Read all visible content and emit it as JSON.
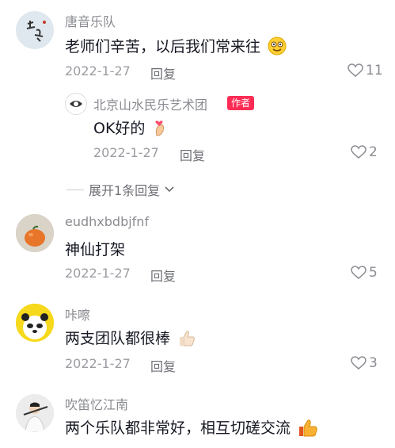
{
  "comments": [
    {
      "username": "唐音乐队",
      "text": "老师们辛苦，以后我们常来往",
      "emoji": "smiling-face-icon",
      "date": "2022-1-27",
      "reply_label": "回复",
      "likes": "11",
      "reply": {
        "username": "北京山水民乐艺术团",
        "badge": "作者",
        "text": "OK好的",
        "emoji": "finger-heart-icon",
        "date": "2022-1-27",
        "reply_label": "回复",
        "likes": "2"
      },
      "expand_label": "展开1条回复"
    },
    {
      "username": "eudhxbdbjfnf",
      "text": "神仙打架",
      "date": "2022-1-27",
      "reply_label": "回复",
      "likes": "5"
    },
    {
      "username": "咔嚓",
      "text": "两支团队都很棒",
      "emoji": "thumbs-up-icon",
      "date": "2022-1-27",
      "reply_label": "回复",
      "likes": "3"
    },
    {
      "username": "吹笛忆江南",
      "text": "两个乐队都非常好，相互切磋交流",
      "emoji": "thumbs-up-icon"
    }
  ],
  "colors": {
    "badge": "#fe2c55",
    "secondary_text": "#8a8b91",
    "primary_text": "#161823"
  }
}
